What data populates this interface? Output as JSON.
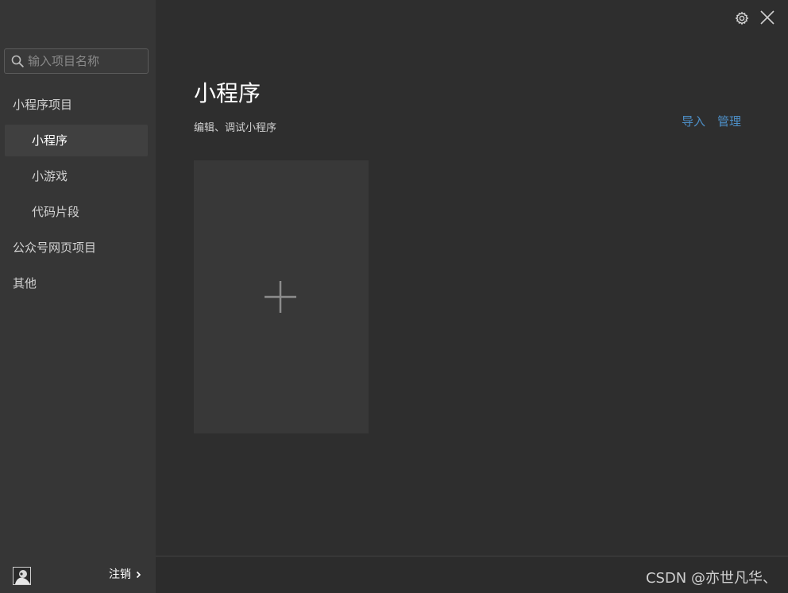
{
  "sidebar": {
    "search": {
      "placeholder": "输入项目名称",
      "value": ""
    },
    "items": [
      {
        "label": "小程序项目"
      },
      {
        "label": "小程序"
      },
      {
        "label": "小游戏"
      },
      {
        "label": "代码片段"
      },
      {
        "label": "公众号网页项目"
      },
      {
        "label": "其他"
      }
    ],
    "active_item": "小程序",
    "footer": {
      "logout_label": "注销"
    }
  },
  "topbar": {
    "icons": [
      "settings-icon",
      "close-icon"
    ]
  },
  "main": {
    "title": "小程序",
    "subtitle": "编辑、调试小程序",
    "actions": {
      "import_label": "导入",
      "manage_label": "管理"
    },
    "new_project_icon": "plus-icon"
  },
  "watermark": "CSDN @亦世凡华、",
  "colors": {
    "sidebar_bg": "#363636",
    "main_bg": "#2e2e2e",
    "active_item_bg": "#404040",
    "link": "#4d8fc7",
    "card_bg": "#383838"
  }
}
